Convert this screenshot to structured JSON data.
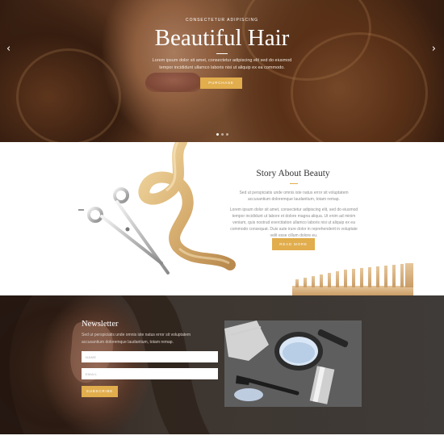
{
  "hero": {
    "kicker": "CONSECTETUR ADIPISCING",
    "title": "Beautiful Hair",
    "text": "Lorem ipsum dolor sit amet, consectetur adipiscing elit sed do eiusmod tempor incididunt ullamco laboris nisi ut aliquip ex ea commodo.",
    "button_label": "PURCHASE",
    "arrow_prev": "‹",
    "arrow_next": "›",
    "slide_count": 3,
    "active_slide": 1
  },
  "story": {
    "title": "Story About Beauty",
    "paragraph1": "Sed ut perspiciatis unde omnis iste natus error sit voluptatem accusantium doloremque laudantium, totam remap.",
    "paragraph2": "Lorem ipsum dolor sit amet, consectetur adipiscing elit, sed do eiusmod tempor incididunt ut labore et dolore magna aliqua. Ut enim ad minim veniam, quis nostrud exercitation ullamco laboris nisi ut aliquip ex ea commodo consequat. Duis aute irure dolor in reprehenderit in voluptate velit esse cillum dolore eu.",
    "button_label": "READ MORE"
  },
  "newsletter": {
    "title": "Newsletter",
    "text": "Sed ut perspiciatis unde omnis iste natus error sit voluptatem accusantium doloremque laudantium, totam remap.",
    "name_placeholder": "NAME",
    "email_placeholder": "EMAIL",
    "button_label": "SUBSCRIBE"
  },
  "colors": {
    "accent": "#e1ad4d",
    "dark_section": "#3e3834",
    "title_text": "#333333",
    "body_text": "#8e8e8e"
  },
  "icons": {
    "prev": "chevron-left-icon",
    "next": "chevron-right-icon"
  }
}
